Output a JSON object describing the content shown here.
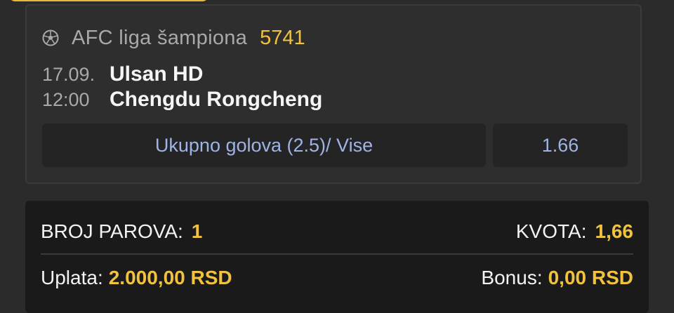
{
  "match": {
    "league_name": "AFC liga šampiona",
    "match_code": "5741",
    "date": "17.09.",
    "time": "12:00",
    "home_team": "Ulsan HD",
    "away_team": "Chengdu Rongcheng",
    "market": "Ukupno golova (2.5)/ Vise",
    "odds": "1.66",
    "icon": "soccer-ball-icon"
  },
  "summary": {
    "pairs_label": "BROJ PAROVA:",
    "pairs_value": "1",
    "odds_label": "KVOTA:",
    "odds_value": "1,66",
    "stake_label": "Uplata:",
    "stake_value": "2.000,00 RSD",
    "bonus_label": "Bonus:",
    "bonus_value": "0,00 RSD"
  },
  "colors": {
    "accent": "#f0c23f",
    "link": "#9fb4e4",
    "background": "#2b2b2b",
    "summary_background": "#1a1a1a"
  }
}
